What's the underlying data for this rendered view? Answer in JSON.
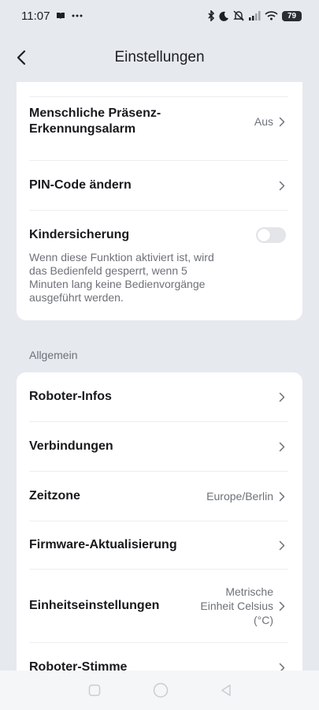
{
  "status_bar": {
    "time": "11:07",
    "battery": "79",
    "icons": [
      "notification-icon",
      "more-dots-icon",
      "bluetooth-icon",
      "moon-icon",
      "mute-icon",
      "signal-icon",
      "wifi-icon",
      "battery-icon"
    ]
  },
  "header": {
    "title": "Einstellungen",
    "back_icon": "chevron-left-icon"
  },
  "card1": {
    "presence_alarm": {
      "label": "Menschliche Präsenz-Erkennungsalarm",
      "value": "Aus"
    },
    "pin": {
      "label": "PIN-Code ändern"
    },
    "child_lock": {
      "label": "Kindersicherung",
      "description": "Wenn diese Funktion aktiviert ist, wird das Bedienfeld gesperrt, wenn 5 Minuten lang keine Bedienvorgänge ausgeführt werden.",
      "enabled": false
    }
  },
  "section_general": "Allgemein",
  "card2": {
    "robot_info": {
      "label": "Roboter-Infos"
    },
    "connections": {
      "label": "Verbindungen"
    },
    "timezone": {
      "label": "Zeitzone",
      "value": "Europe/Berlin"
    },
    "firmware": {
      "label": "Firmware-Aktualisierung"
    },
    "units": {
      "label": "Einheitseinstellungen",
      "value": "Metrische Einheit Celsius (°C)"
    },
    "voice": {
      "label": "Roboter-Stimme"
    }
  },
  "nav_bar": {
    "icons": [
      "recent-apps-icon",
      "home-icon",
      "back-icon"
    ]
  },
  "colors": {
    "background": "#e6e9ee",
    "card": "#ffffff",
    "secondary_text": "#6d7178"
  }
}
